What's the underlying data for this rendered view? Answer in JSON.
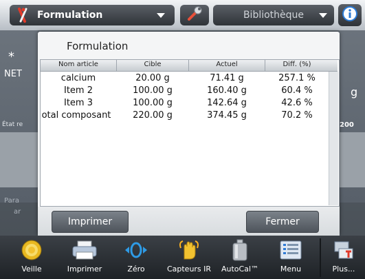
{
  "topbar": {
    "app_label": "Formulation",
    "app_icon": "flask-person-icon",
    "tool_icon": "wrench-icon",
    "library_label": "Bibliothèque",
    "info_icon": "info-icon"
  },
  "background": {
    "star": "*",
    "net": "NET",
    "etat": "État re",
    "unit": "g",
    "partial_value": "200",
    "para": "Para",
    "para2": "ar"
  },
  "dialog": {
    "title": "Formulation",
    "columns": [
      "Nom article",
      "Cible",
      "Actuel",
      "Diff. (%)"
    ],
    "rows": [
      {
        "name": "calcium",
        "target": "20.00 g",
        "actual": "71.41 g",
        "diff": "257.1 %"
      },
      {
        "name": "Item 2",
        "target": "100.00 g",
        "actual": "160.40 g",
        "diff": "60.4 %"
      },
      {
        "name": "Item 3",
        "target": "100.00 g",
        "actual": "142.64 g",
        "diff": "42.6 %"
      },
      {
        "name": "otal composant",
        "target": "220.00 g",
        "actual": "374.45 g",
        "diff": "70.2 %"
      }
    ],
    "print_label": "Imprimer",
    "close_label": "Fermer"
  },
  "bottombar": {
    "items": [
      {
        "label": "Veille",
        "icon": "standby-icon"
      },
      {
        "label": "Imprimer",
        "icon": "printer-icon"
      },
      {
        "label": "Zéro",
        "icon": "zero-icon"
      },
      {
        "label": "Capteurs IR",
        "icon": "hand-sensor-icon"
      },
      {
        "label": "AutoCal™",
        "icon": "calibration-weight-icon"
      },
      {
        "label": "Menu",
        "icon": "menu-icon"
      },
      {
        "label": "Plus...",
        "icon": "more-icon"
      }
    ]
  },
  "colors": {
    "accent_yellow": "#f2c230",
    "dialog_bg": "#f4f5f6",
    "button_dark": "#4e545b"
  }
}
